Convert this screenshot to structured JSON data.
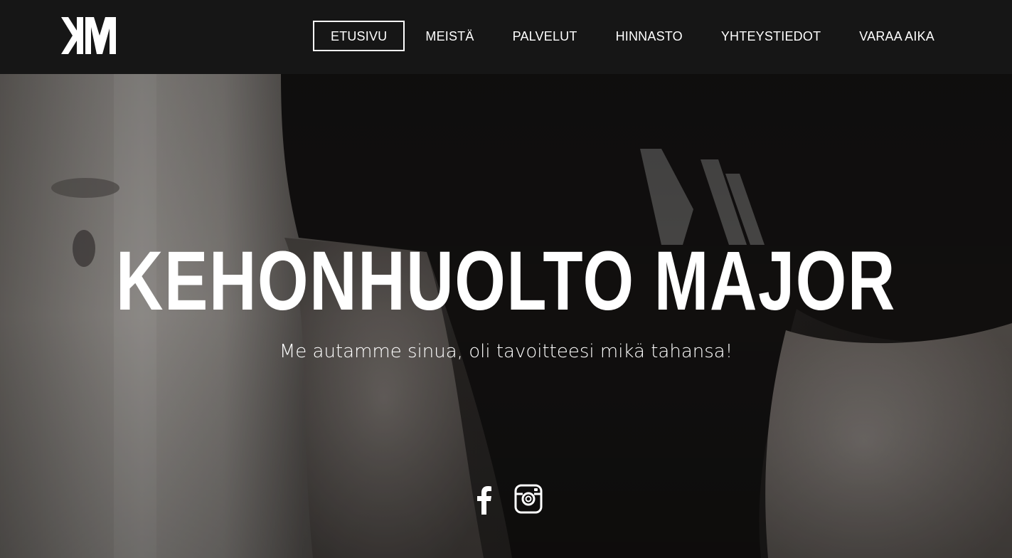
{
  "brand": {
    "logo_icon": "km-logo-icon"
  },
  "nav": {
    "items": [
      {
        "label": "ETUSIVU",
        "active": true
      },
      {
        "label": "MEISTÄ",
        "active": false
      },
      {
        "label": "PALVELUT",
        "active": false
      },
      {
        "label": "HINNASTO",
        "active": false
      },
      {
        "label": "YHTEYSTIEDOT",
        "active": false
      },
      {
        "label": "VARAA AIKA",
        "active": false
      }
    ]
  },
  "hero": {
    "title": "KEHONHUOLTO MAJOR",
    "subtitle": "Me autamme sinua, oli tavoitteesi mikä tahansa!",
    "background_icon": "trainer-photo"
  },
  "social": {
    "icons": [
      "facebook-icon",
      "instagram-icon"
    ]
  },
  "colors": {
    "header_bg": "#161616",
    "text": "#ffffff"
  }
}
